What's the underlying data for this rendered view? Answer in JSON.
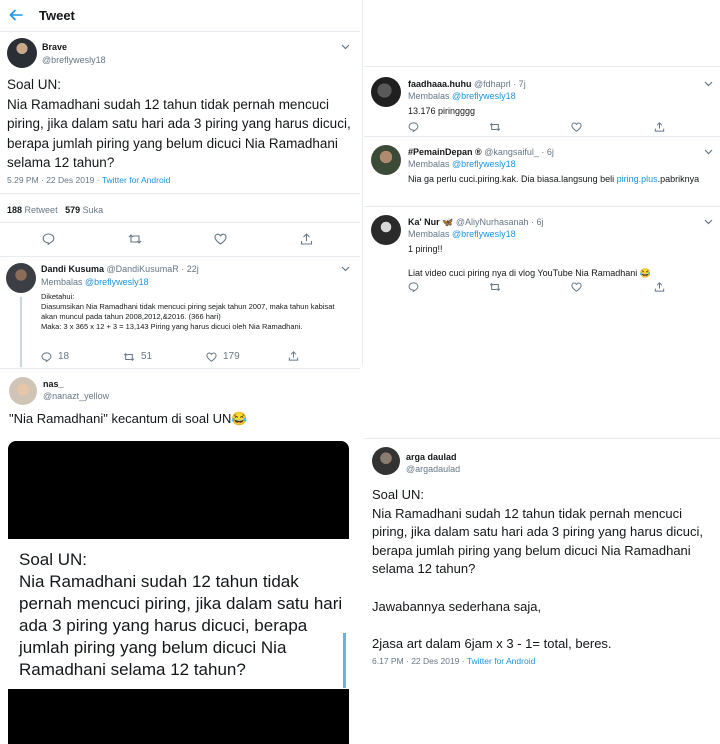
{
  "header": {
    "back_icon": "arrow-left-icon",
    "title": "Tweet"
  },
  "main_tweet": {
    "name": "Brave",
    "handle": "@breflywesly18",
    "text": "Soal UN:\nNia Ramadhani sudah 12 tahun tidak pernah mencuci piring, jika dalam satu hari ada 3 piring yang harus dicuci, berapa jumlah piring yang belum dicuci Nia Ramadhani selama 12 tahun?",
    "time": "5.29 PM · 22 Des 2019 · ",
    "source": "Twitter for Android",
    "retweets_count": "188",
    "retweets_label": "Retweet",
    "likes_count": "579",
    "likes_label": "Suka"
  },
  "replies_left": [
    {
      "name": "Dandi Kusuma",
      "handle": "@DandiKusumaR · 22j",
      "replying_prefix": "Membalas ",
      "replying_to": "@breflywesly18",
      "text": "Diketahui:\nDiasumsikan Nia Ramadhani tidak mencuci piring sejak tahun 2007, maka tahun kabisat akan muncul pada tahun 2008,2012,&2016. (366 hari)\nMaka: 3 x 365 x 12 + 3 = 13,143 Piring yang harus dicuci oleh Nia Ramadhani.",
      "replies": "18",
      "retweets": "51",
      "likes": "179"
    }
  ],
  "replies_right": [
    {
      "name": "faadhaaa.huhu",
      "handle": "@fdhaprl · 7j",
      "replying_prefix": "Membalas ",
      "replying_to": "@breflywesly18",
      "text": "13.176 piringggg"
    },
    {
      "name": "#PemainDepan ®",
      "handle": "@kangsaiful_ · 6j",
      "replying_prefix": "Membalas ",
      "replying_to": "@breflywesly18",
      "text_before": "Nia ga perlu cuci.piring.kak. Dia biasa.langsung beli ",
      "text_link": "piring.plus",
      "text_after": ".pabriknya"
    },
    {
      "name": "Ka' Nur 🦋",
      "handle": "@AliyNurhasanah · 6j",
      "replying_prefix": "Membalas ",
      "replying_to": "@breflywesly18",
      "text": "1 piring!!\n\nLiat video cuci piring nya di vlog YouTube Nia Ramadhani 😂"
    }
  ],
  "nas_tweet": {
    "name": "nas_",
    "handle": "@nanazt_yellow",
    "text": "\"Nia Ramadhani\" kecantum di soal UN😂",
    "image_text": "Soal UN:\nNia Ramadhani sudah 12 tahun tidak pernah mencuci piring, jika dalam satu hari ada 3 piring yang harus dicuci, berapa jumlah piring yang belum dicuci Nia Ramadhani selama 12 tahun?"
  },
  "arga_tweet": {
    "name": "arga daulad",
    "handle": "@argadaulad",
    "text": "Soal UN:\nNia Ramadhani sudah 12 tahun tidak pernah mencuci piring, jika dalam satu hari ada 3 piring yang harus dicuci, berapa jumlah piring yang belum dicuci Nia Ramadhani selama 12 tahun?\n\nJawabannya sederhana saja,\n\n2jasa art dalam 6jam x 3 - 1= total, beres.",
    "time": "6.17 PM · 22 Des 2019 · ",
    "source": "Twitter for Android"
  },
  "colors": {
    "accent": "#1b95e0",
    "muted": "#657786",
    "divider": "#e6ecf0"
  }
}
